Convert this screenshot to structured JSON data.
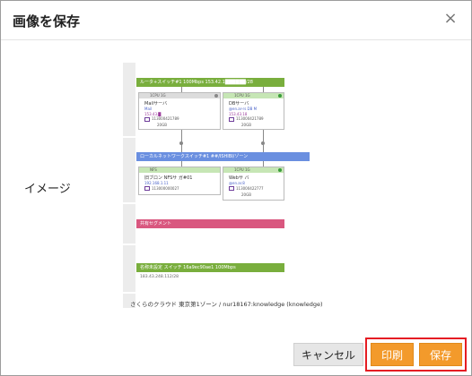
{
  "dialog": {
    "title": "画像を保存",
    "close_glyph": "×",
    "image_label": "イメージ"
  },
  "preview": {
    "router_segment": "ルータ+スイッチ#1  100Mbps  153.42.1██████/28",
    "local_switch_segment": "ローカルネットワークスイッチ#1  ##/ISHIBI/ゾーン",
    "shared_segment": "共有セグメント",
    "vpc_segment": "名称未設定 スイッチ  16a9ec90ae1  100Mbps",
    "vpc_segment_sub": "183.43.248.112/28",
    "server_mail": {
      "spec": "1CPU 1G",
      "name": "Mailサーバ",
      "ip": "Mail",
      "ip2": "153.43.█",
      "id": "113000421789",
      "size": "20GB"
    },
    "server_db": {
      "spec": "1CPU 1G",
      "name": "DBサーバ",
      "ip": "@en.ar-rs  DB  M",
      "ip2": "153.43.18",
      "id": "113000421789",
      "size": "20GB"
    },
    "server_nfs": {
      "spec": "NFS",
      "name": "旧ブロン NFSサ  ガ#01",
      "ip": "192.168.1.11",
      "ip2": "",
      "id": "113000000027",
      "size": ""
    },
    "server_web": {
      "spec": "1CPU 1G",
      "name": "Webサ  バ",
      "ip": "@en.ar.8",
      "ip2": "",
      "id": "113000422777",
      "size": "20GB"
    },
    "footer": "さくらのクラウド 東京第1ゾーン / nur18167:knowledge (knowledge)"
  },
  "buttons": {
    "cancel": "キャンセル",
    "print": "印刷",
    "save": "保存"
  },
  "colors": {
    "segment_green": "#79ae3d",
    "segment_blue": "#6a8fe0",
    "segment_pink": "#d9577f",
    "server_bar_gray": "#dcdcdc",
    "server_bar_green": "#c6e6b5",
    "accent_orange": "#f39a2b",
    "highlight_red": "#e51c23"
  }
}
